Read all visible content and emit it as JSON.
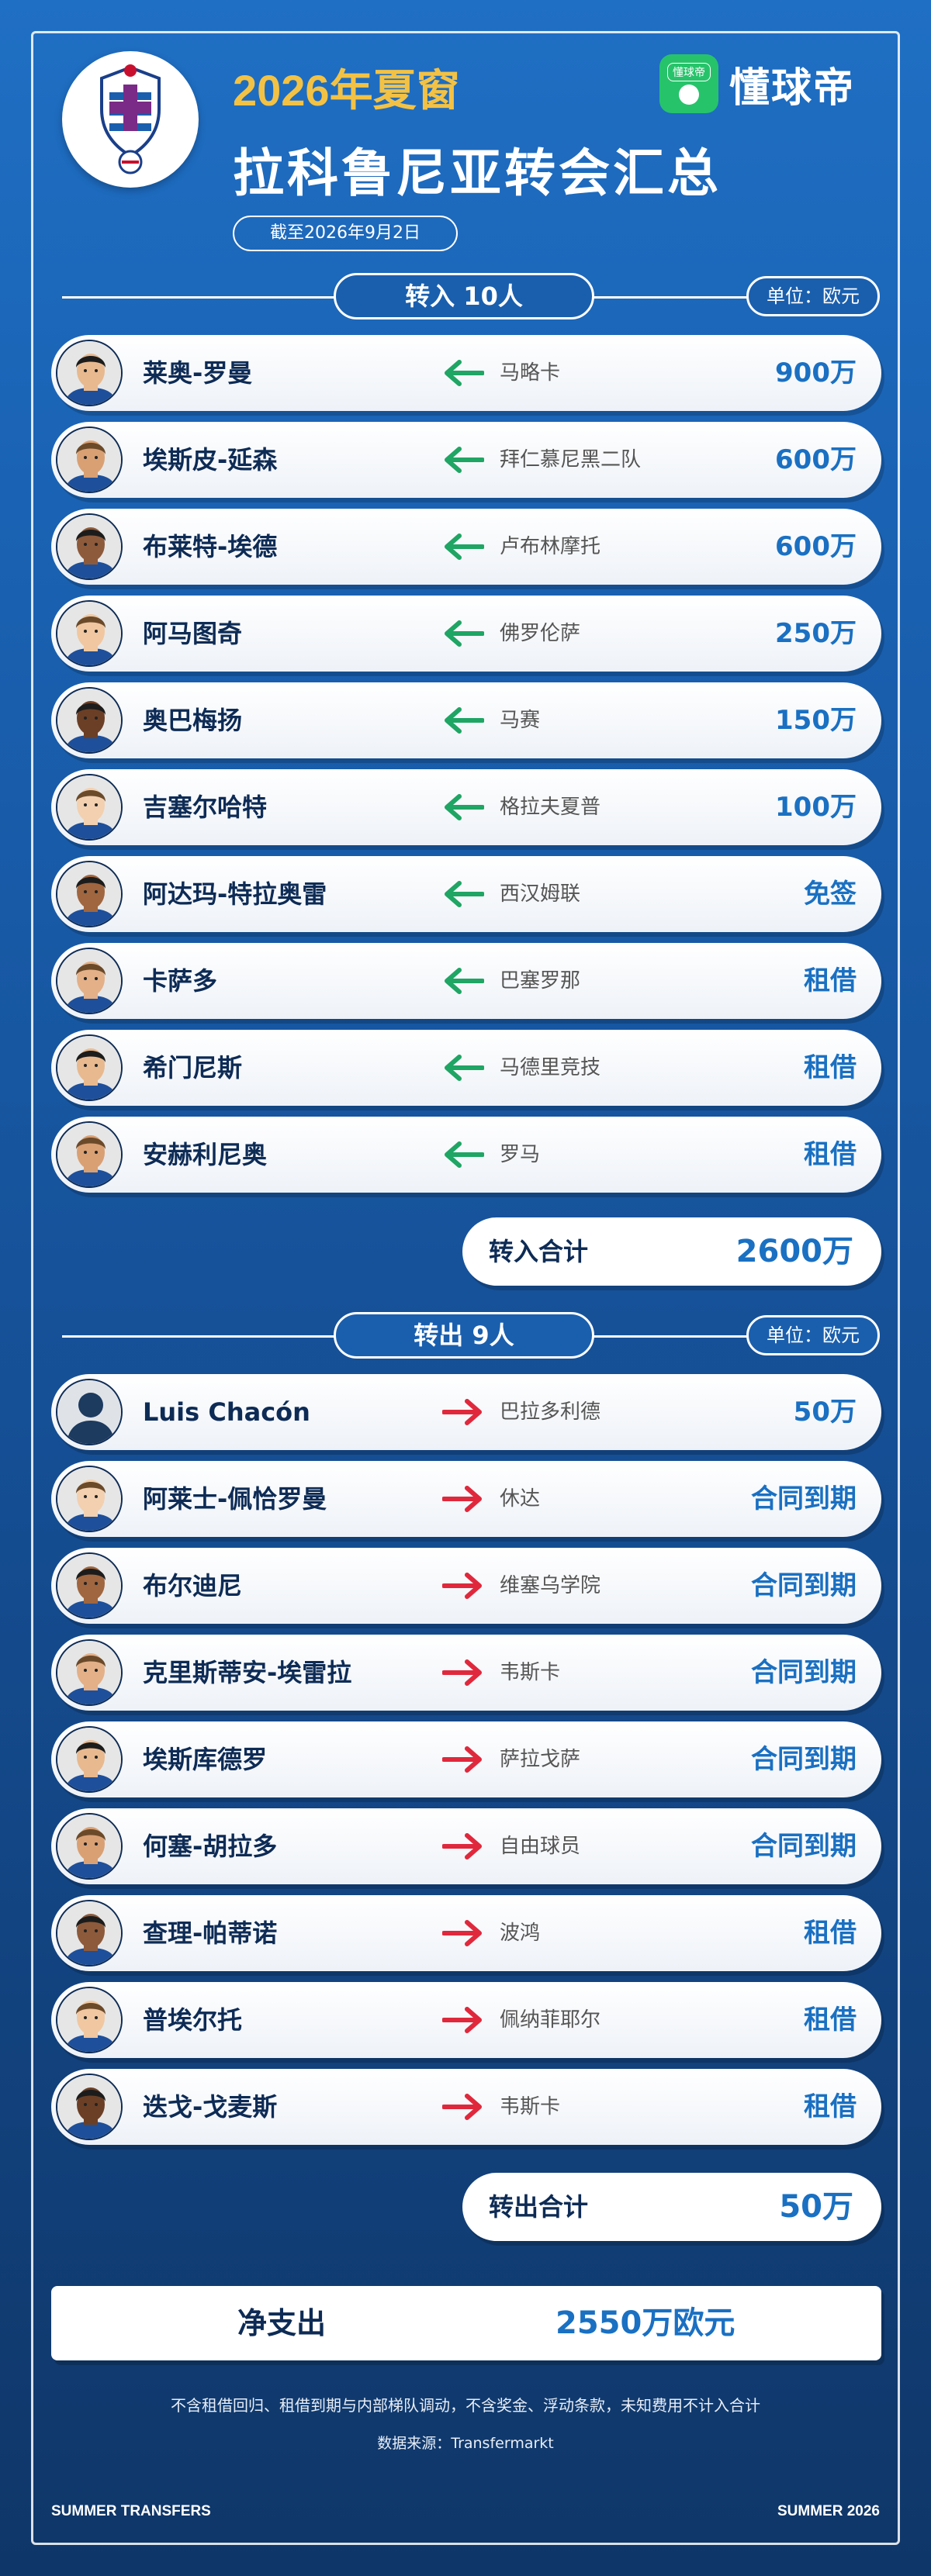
{
  "header": {
    "title_year": "2026年夏窗",
    "title_main": "拉科鲁尼亚转会汇总",
    "date": "截至2026年9月2日",
    "brand_name": "懂球帝",
    "brand_icon_text": "懂球帝"
  },
  "transfers_in": {
    "section_label": "转入 10人",
    "unit_label": "单位：欧元",
    "total_label": "转入合计",
    "total_value": "2600万",
    "rows": [
      {
        "name": "莱奥-罗曼",
        "club": "马略卡",
        "fee": "900万"
      },
      {
        "name": "埃斯皮-延森",
        "club": "拜仁慕尼黑二队",
        "fee": "600万"
      },
      {
        "name": "布莱特-埃德",
        "club": "卢布林摩托",
        "fee": "600万"
      },
      {
        "name": "阿马图奇",
        "club": "佛罗伦萨",
        "fee": "250万"
      },
      {
        "name": "奥巴梅扬",
        "club": "马赛",
        "fee": "150万"
      },
      {
        "name": "吉塞尔哈特",
        "club": "格拉夫夏普",
        "fee": "100万"
      },
      {
        "name": "阿达玛-特拉奥雷",
        "club": "西汉姆联",
        "fee": "免签"
      },
      {
        "name": "卡萨多",
        "club": "巴塞罗那",
        "fee": "租借"
      },
      {
        "name": "希门尼斯",
        "club": "马德里竞技",
        "fee": "租借"
      },
      {
        "name": "安赫利尼奥",
        "club": "罗马",
        "fee": "租借"
      }
    ]
  },
  "transfers_out": {
    "section_label": "转出 9人",
    "unit_label": "单位：欧元",
    "total_label": "转出合计",
    "total_value": "50万",
    "rows": [
      {
        "name": "Luis Chacón",
        "club": "巴拉多利德",
        "fee": "50万"
      },
      {
        "name": "阿莱士-佩恰罗曼",
        "club": "休达",
        "fee": "合同到期"
      },
      {
        "name": "布尔迪尼",
        "club": "维塞乌学院",
        "fee": "合同到期"
      },
      {
        "name": "克里斯蒂安-埃雷拉",
        "club": "韦斯卡",
        "fee": "合同到期"
      },
      {
        "name": "埃斯库德罗",
        "club": "萨拉戈萨",
        "fee": "合同到期"
      },
      {
        "name": "何塞-胡拉多",
        "club": "自由球员",
        "fee": "合同到期"
      },
      {
        "name": "查理-帕蒂诺",
        "club": "波鸿",
        "fee": "租借"
      },
      {
        "name": "普埃尔托",
        "club": "佩纳菲耶尔",
        "fee": "租借"
      },
      {
        "name": "迭戈-戈麦斯",
        "club": "韦斯卡",
        "fee": "租借"
      }
    ]
  },
  "net": {
    "label": "净支出",
    "value": "2550万欧元"
  },
  "footer": {
    "note": "不含租借回归、租借到期与内部梯队调动，不含奖金、浮动条款，未知费用不计入合计",
    "source": "数据来源：Transfermarkt",
    "left_corner": "SUMMER TRANSFERS",
    "right_corner": "SUMMER 2026"
  },
  "colors": {
    "accent": "#1a70c2",
    "year": "#f3c244",
    "arrow_in": "#1fa564",
    "arrow_out": "#e0283c",
    "brand_green": "#27c36b"
  }
}
